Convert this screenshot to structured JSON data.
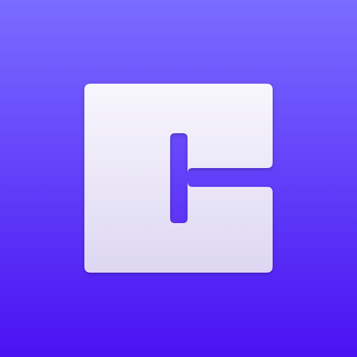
{
  "icon": {
    "name": "app-logo-icon",
    "description_visible_text": "",
    "colors": {
      "background_top": "#7a6cff",
      "background_bottom": "#4a12f3",
      "glyph_top": "#f8f6fd",
      "glyph_bottom": "#ddd7f2",
      "cutout": "#5b2df2"
    }
  }
}
